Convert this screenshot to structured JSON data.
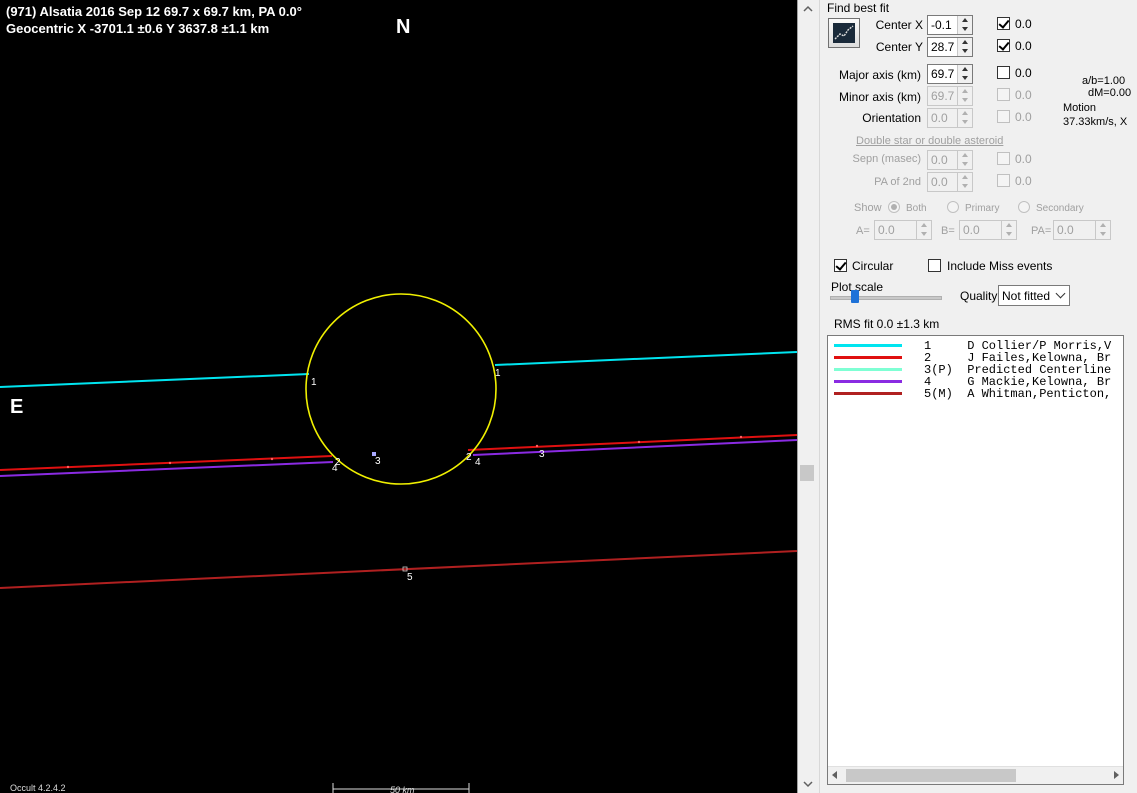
{
  "plot": {
    "title_line1": "(971) Alsatia  2016 Sep 12  69.7 x 69.7 km, PA 0.0°",
    "title_line2": "Geocentric  X  -3701.1 ±0.6  Y 3637.8 ±1.1 km",
    "north": "N",
    "east": "E",
    "version": "Occult 4.2.4.2",
    "scale_label": "50 km",
    "chord_labels": [
      "1",
      "2",
      "3",
      "4",
      "5"
    ],
    "colors": {
      "background": "#000000",
      "ellipse": "#f0f000",
      "chord1": "#00e5f0",
      "chord2": "#e01010",
      "chord3": "#8888ff",
      "chord4": "#8a2be2",
      "chord5": "#b02020"
    }
  },
  "panel": {
    "find_best_fit": "Find best fit",
    "center_x_label": "Center X",
    "center_x": "-0.1",
    "center_x_step": "0.0",
    "center_y_label": "Center Y",
    "center_y": "28.7",
    "center_y_step": "0.0",
    "major_axis_label": "Major axis (km)",
    "major_axis": "69.7",
    "major_axis_step": "0.0",
    "minor_axis_label": "Minor axis (km)",
    "minor_axis": "69.7",
    "minor_axis_step": "0.0",
    "orientation_label": "Orientation",
    "orientation": "0.0",
    "orientation_step": "0.0",
    "ratio": "a/b=1.00",
    "dm": "dM=0.00",
    "motion_label": "Motion",
    "motion_value": "37.33km/s, X",
    "double_star_link": "Double star  or  double asteroid",
    "sepn_label": "Sepn (masec)",
    "sepn": "0.0",
    "sepn_step": "0.0",
    "pa2_label": "PA of 2nd",
    "pa2": "0.0",
    "pa2_step": "0.0",
    "show_label": "Show",
    "show_both": "Both",
    "show_primary": "Primary",
    "show_secondary": "Secondary",
    "a_label": "A=",
    "a_value": "0.0",
    "b_label": "B=",
    "b_value": "0.0",
    "pa_label": "PA=",
    "pa_value": "0.0",
    "circular_label": "Circular",
    "include_miss_label": "Include Miss events",
    "plot_scale_label": "Plot scale",
    "quality_label": "Quality",
    "quality_value": "Not fitted",
    "rms_fit": "RMS fit  0.0 ±1.3 km",
    "legend": [
      {
        "text": "1     D Collier/P Morris,V",
        "color": "#00e5f0"
      },
      {
        "text": "2     J Failes,Kelowna, Br",
        "color": "#e01010"
      },
      {
        "text": "3(P)  Predicted Centerline",
        "color": "#7fffd4"
      },
      {
        "text": "4     G Mackie,Kelowna, Br",
        "color": "#8a2be2"
      },
      {
        "text": "5(M)  A Whitman,Penticton,",
        "color": "#b02020"
      }
    ]
  }
}
